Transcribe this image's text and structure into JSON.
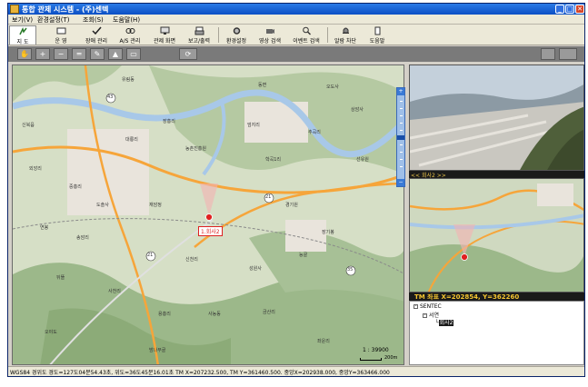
{
  "window": {
    "title": "통합 관제 시스템 - (주)센텍",
    "minimize": "_",
    "maximize": "□",
    "close": "✕"
  },
  "menu": [
    {
      "label": "보기(V)"
    },
    {
      "label": "환경설정(T)"
    },
    {
      "label": "조회(S)"
    },
    {
      "label": "도움말(H)"
    }
  ],
  "toolbar": {
    "buttons": [
      {
        "label": "지 도",
        "icon": "map-icon"
      },
      {
        "label": "운 영",
        "icon": "monitor-icon"
      },
      {
        "label": "장애 관리",
        "icon": "check-icon"
      },
      {
        "label": "A/S 관리",
        "icon": "link-icon"
      },
      {
        "label": "관제 화면",
        "icon": "screen-icon"
      },
      {
        "label": "보고/출력",
        "icon": "printer-icon"
      },
      {
        "label": "환경설정",
        "icon": "gear-icon"
      },
      {
        "label": "영상 검색",
        "icon": "camera-icon"
      },
      {
        "label": "이벤트 검색",
        "icon": "search-icon"
      },
      {
        "label": "알람 차단",
        "icon": "bell-icon"
      },
      {
        "label": "도움말",
        "icon": "help-icon"
      }
    ]
  },
  "map_tools": [
    {
      "name": "pan-tool-button",
      "glyph": "✋"
    },
    {
      "name": "zoom-in-tool-button",
      "glyph": "+"
    },
    {
      "name": "zoom-out-tool-button",
      "glyph": "−"
    },
    {
      "name": "measure-tool-button",
      "glyph": "═"
    },
    {
      "name": "erase-tool-button",
      "glyph": "✎"
    },
    {
      "name": "area-tool-button",
      "glyph": "▲"
    },
    {
      "name": "print-tool-button",
      "glyph": "▭"
    },
    {
      "name": "refresh-tool-button",
      "glyph": "⟳"
    }
  ],
  "map": {
    "marker_label": "1.회사2",
    "route_numbers": [
      "43",
      "21",
      "21",
      "35"
    ],
    "scale_ratio": "1 : 39900",
    "scale_unit": "200m",
    "place_labels": [
      "유림동",
      "동면",
      "오도사",
      "장흥리",
      "엄지리",
      "추곡리",
      "상암사",
      "선유원",
      "학곡1리",
      "농촌진흥원",
      "대룡리",
      "신북읍",
      "외앙리",
      "중흥리",
      "도솔사",
      "재암정",
      "경기원",
      "장기봉",
      "능골",
      "연봉",
      "송암리",
      "신천리",
      "성원사",
      "뒤뜰",
      "사천리",
      "용흥리",
      "사농동",
      "오야도",
      "금산리",
      "밤나무골",
      "좌운리"
    ]
  },
  "right_panel": {
    "cctv_bar_label": "<< 회사2 >>",
    "tm_coords": "TM 좌표 X=202854, Y=362260",
    "tree": {
      "root": "SENTEC",
      "child": "서연",
      "leaf": "회사2"
    }
  },
  "status": {
    "text": "WGS84 경위도 경도=127도04분54.43초, 위도=36도45분16.01초  TM X=207232.500, TM Y=361460.500. 중앙X=202938.000, 중앙Y=363466.000"
  }
}
